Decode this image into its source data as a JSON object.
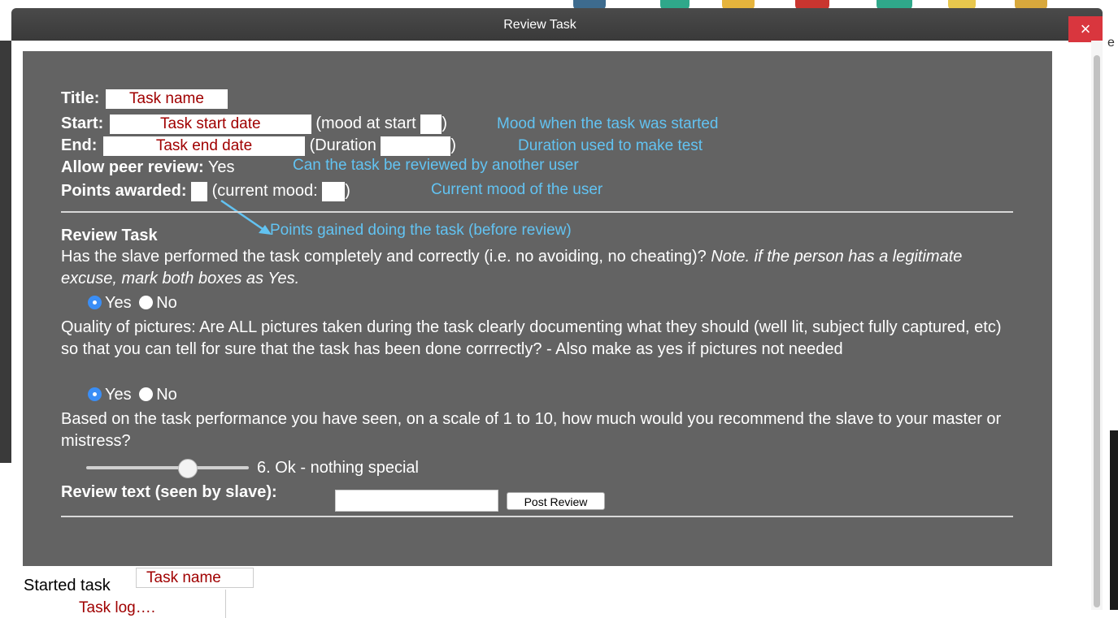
{
  "background": {
    "edge_letter": "e"
  },
  "dialog": {
    "title": "Review Task",
    "close_glyph": "×"
  },
  "info": {
    "title_label": "Title:",
    "title_value": "Task name",
    "start_label": "Start:",
    "start_value": "Task start date",
    "mood_at_start_prefix": "(mood at start",
    "mood_at_start_suffix": ")",
    "end_label": "End:",
    "end_value": "Task end date",
    "duration_prefix": "(Duration",
    "duration_suffix": ")",
    "peer_review_label": "Allow peer review:",
    "peer_review_value": "Yes",
    "points_label": "Points awarded:",
    "current_mood_prefix": "(current mood:",
    "current_mood_suffix": ")"
  },
  "annotations": {
    "mood_start": "Mood when the task was started",
    "duration": "Duration used to make test",
    "peer_review": "Can the task be reviewed by another user",
    "current_mood": "Current mood of the user",
    "points": "Points gained doing the task (before review)"
  },
  "review": {
    "heading": "Review Task",
    "q1_text": "Has the slave performed the task completely and correctly (i.e. no avoiding, no cheating)?",
    "q1_note": "Note. if the person has a legitimate excuse, mark both boxes as Yes.",
    "q1_yes": "Yes",
    "q1_no": "No",
    "q1_selected": "Yes",
    "q2_text": "Quality of pictures: Are ALL pictures taken during the task clearly documenting what they should (well lit, subject fully captured, etc) so that you can tell for sure that the task has been done corrrectly? - Also make as yes if pictures not needed",
    "q2_yes": "Yes",
    "q2_no": "No",
    "q2_selected": "Yes",
    "q3_text": "Based on the task performance you have seen, on a scale of 1 to 10, how much would you recommend the slave to your master or mistress?",
    "slider_value": 6,
    "slider_min": 1,
    "slider_max": 10,
    "slider_label": "6. Ok - nothing special",
    "review_text_label": "Review text (seen by slave):",
    "review_text_value": "",
    "post_button": "Post Review"
  },
  "log": {
    "started_label": "Started task",
    "task_name": "Task name",
    "task_log": "Task log…."
  },
  "colors": {
    "panel": "#636363",
    "annotation": "#62c3f2",
    "redacted_label": "#a00000",
    "close": "#d9363e",
    "radio_selected": "#3a8ef6"
  }
}
